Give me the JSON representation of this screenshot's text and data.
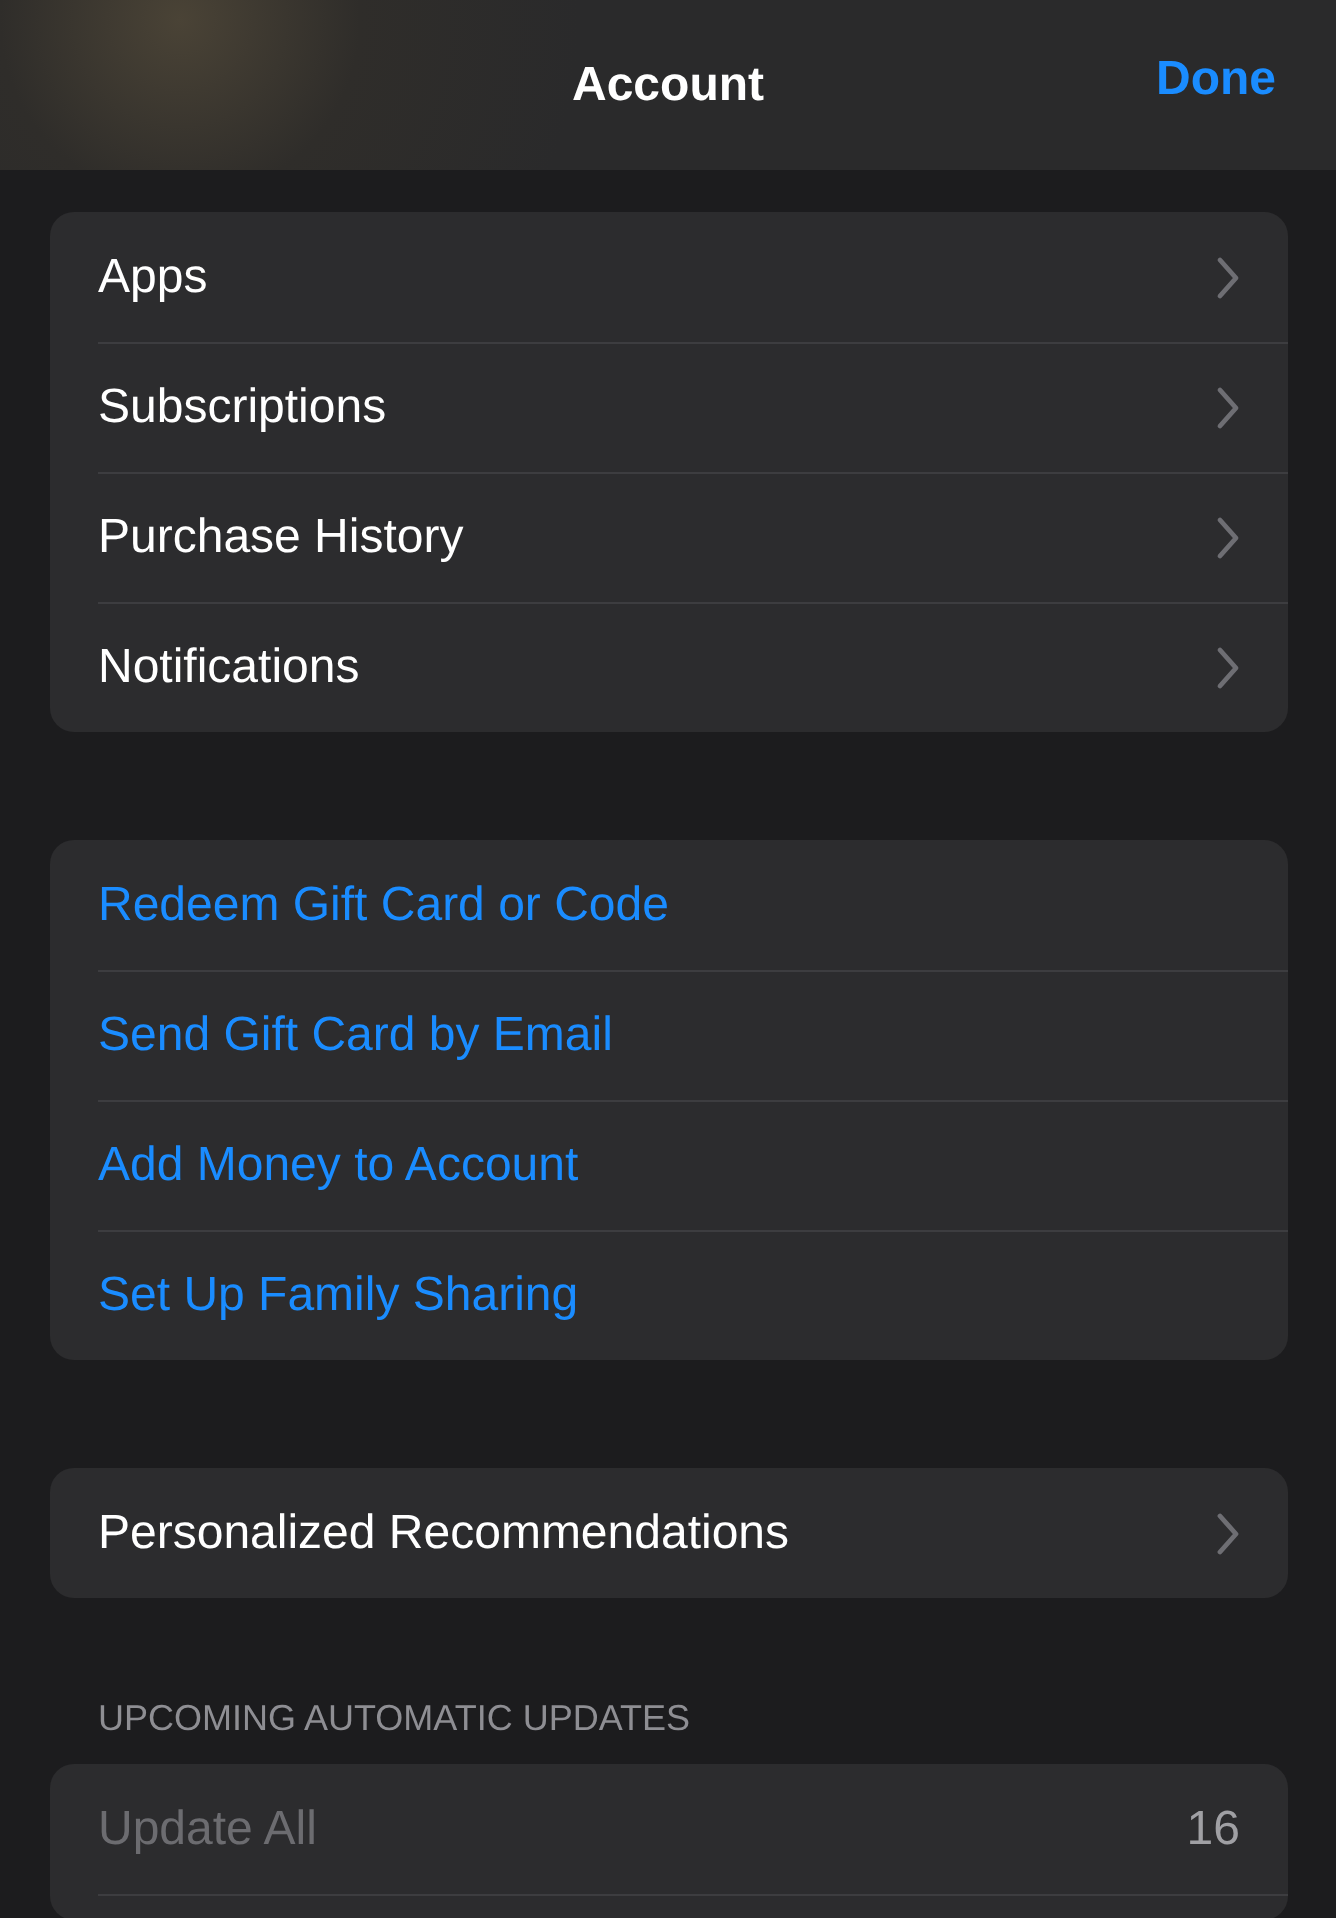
{
  "header": {
    "title": "Account",
    "done": "Done"
  },
  "groups": [
    {
      "rows": [
        {
          "label": "Apps",
          "kind": "nav"
        },
        {
          "label": "Subscriptions",
          "kind": "nav"
        },
        {
          "label": "Purchase History",
          "kind": "nav"
        },
        {
          "label": "Notifications",
          "kind": "nav"
        }
      ]
    },
    {
      "rows": [
        {
          "label": "Redeem Gift Card or Code",
          "kind": "link"
        },
        {
          "label": "Send Gift Card by Email",
          "kind": "link"
        },
        {
          "label": "Add Money to Account",
          "kind": "link"
        },
        {
          "label": "Set Up Family Sharing",
          "kind": "link"
        }
      ]
    },
    {
      "rows": [
        {
          "label": "Personalized Recommendations",
          "kind": "nav"
        }
      ]
    },
    {
      "header": "UPCOMING AUTOMATIC UPDATES",
      "rows": [
        {
          "label": "Update All",
          "kind": "value",
          "value": "16",
          "disabled": true
        }
      ],
      "more_below": true
    }
  ]
}
